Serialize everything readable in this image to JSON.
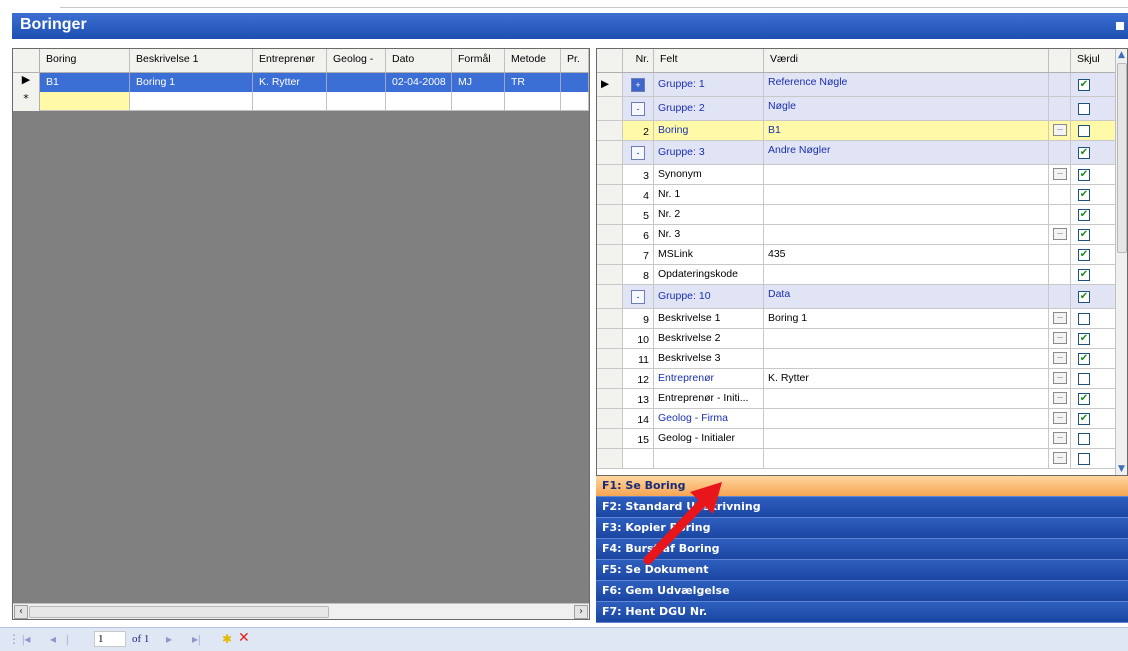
{
  "window": {
    "title": "Boringer"
  },
  "left_grid": {
    "columns": [
      "Boring",
      "Beskrivelse 1",
      "Entreprenør",
      "Geolog -",
      "Dato",
      "Formål",
      "Metode",
      "Pr."
    ],
    "rows": [
      [
        "B1",
        "Boring 1",
        "K. Rytter",
        "",
        "02-04-2008",
        "MJ",
        "TR",
        ""
      ]
    ],
    "selected_marker": "▶",
    "new_row_marker": "*"
  },
  "right_grid": {
    "columns": [
      "Nr.",
      "Felt",
      "Værdi",
      "",
      "Skjul"
    ],
    "rows": [
      {
        "kind": "group",
        "button": "+",
        "felt": "Gruppe: 1",
        "value": "Reference Nøgle",
        "hide": true,
        "current": true
      },
      {
        "kind": "group",
        "button": "-",
        "felt": "Gruppe: 2",
        "value": "Nøgle",
        "hide": false
      },
      {
        "kind": "highlight",
        "nr": "2",
        "felt": "Boring",
        "value": "B1",
        "ellipsis": true,
        "hide": false
      },
      {
        "kind": "group",
        "button": "-",
        "felt": "Gruppe: 3",
        "value": "Andre Nøgler",
        "hide": true
      },
      {
        "kind": "field",
        "nr": "3",
        "felt": "Synonym",
        "value": "",
        "ellipsis": true,
        "hide": true
      },
      {
        "kind": "field",
        "nr": "4",
        "felt": "Nr. 1",
        "value": "",
        "ellipsis": false,
        "hide": true
      },
      {
        "kind": "field",
        "nr": "5",
        "felt": "Nr. 2",
        "value": "",
        "ellipsis": false,
        "hide": true
      },
      {
        "kind": "field",
        "nr": "6",
        "felt": "Nr. 3",
        "value": "",
        "ellipsis": true,
        "hide": true
      },
      {
        "kind": "field",
        "nr": "7",
        "felt": "MSLink",
        "value": "435",
        "ellipsis": false,
        "hide": true
      },
      {
        "kind": "field",
        "nr": "8",
        "felt": "Opdateringskode",
        "value": "",
        "ellipsis": false,
        "hide": true
      },
      {
        "kind": "group",
        "button": "-",
        "felt": "Gruppe: 10",
        "value": "Data",
        "hide": true
      },
      {
        "kind": "field",
        "nr": "9",
        "felt": "Beskrivelse 1",
        "value": "Boring 1",
        "ellipsis": true,
        "hide": false
      },
      {
        "kind": "field",
        "nr": "10",
        "felt": "Beskrivelse 2",
        "value": "",
        "ellipsis": true,
        "hide": true
      },
      {
        "kind": "field",
        "nr": "11",
        "felt": "Beskrivelse 3",
        "value": "",
        "ellipsis": true,
        "hide": true
      },
      {
        "kind": "blue",
        "nr": "12",
        "felt": "Entreprenør",
        "value": "K. Rytter",
        "ellipsis": true,
        "hide": false
      },
      {
        "kind": "field",
        "nr": "13",
        "felt": "Entreprenør - Initi...",
        "value": "",
        "ellipsis": true,
        "hide": true
      },
      {
        "kind": "blue",
        "nr": "14",
        "felt": "Geolog - Firma",
        "value": "",
        "ellipsis": true,
        "hide": true
      },
      {
        "kind": "field",
        "nr": "15",
        "felt": "Geolog - Initialer",
        "value": "",
        "ellipsis": true,
        "hide": false
      },
      {
        "kind": "field",
        "nr": "",
        "felt": "",
        "value": "",
        "ellipsis": true,
        "hide": false
      }
    ]
  },
  "commands": [
    "F1: Se Boring",
    "F2: Standard Udskrivning",
    "F3: Kopier Boring",
    "F4: Burst af Boring",
    "F5: Se Dokument",
    "F6: Gem Udvælgelse",
    "F7: Hent DGU Nr."
  ],
  "active_command_index": 0,
  "navigator": {
    "page": "1",
    "of_label": "of 1"
  },
  "colors": {
    "title_bar": "#1d4fb3",
    "command_bar": "#1b46a2",
    "active_command": "#f6a552",
    "arrow": "#e8151b"
  }
}
